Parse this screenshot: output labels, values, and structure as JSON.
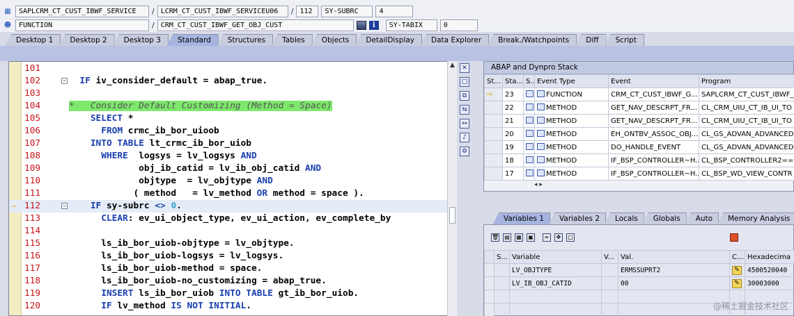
{
  "header": {
    "row1": [
      "SAPLCRM_CT_CUST_IBWF_SERVICE",
      "LCRM_CT_CUST_IBWF_SERVICEU06",
      "112",
      "SY-SUBRC",
      "4"
    ],
    "row2": [
      "FUNCTION",
      "CRM_CT_CUST_IBWF_GET_OBJ_CUST",
      "SY-TABIX",
      "0"
    ]
  },
  "tabs": [
    "Desktop 1",
    "Desktop 2",
    "Desktop 3",
    "Standard",
    "Structures",
    "Tables",
    "Objects",
    "DetailDisplay",
    "Data Explorer",
    "Break./Watchpoints",
    "Diff",
    "Script"
  ],
  "active_tab": "Standard",
  "code": {
    "lines": [
      {
        "n": "101",
        "t": ""
      },
      {
        "n": "102",
        "t": "  IF iv_consider_default = abap_true."
      },
      {
        "n": "103",
        "t": ""
      },
      {
        "n": "104",
        "t": "*   Consider Default Customizing (Method = Space)"
      },
      {
        "n": "105",
        "t": "    SELECT *"
      },
      {
        "n": "106",
        "t": "      FROM crmc_ib_bor_uioob"
      },
      {
        "n": "107",
        "t": "    INTO TABLE lt_crmc_ib_bor_uiob"
      },
      {
        "n": "108",
        "t": "      WHERE  logsys = lv_logsys AND"
      },
      {
        "n": "109",
        "t": "             obj_ib_catid = lv_ib_obj_catid AND"
      },
      {
        "n": "110",
        "t": "             objtype  = lv_objtype AND"
      },
      {
        "n": "111",
        "t": "            ( method   = lv_method OR method = space )."
      },
      {
        "n": "112",
        "t": "    IF sy-subrc <> 0."
      },
      {
        "n": "113",
        "t": "      CLEAR: ev_ui_object_type, ev_ui_action, ev_complete_by"
      },
      {
        "n": "114",
        "t": ""
      },
      {
        "n": "115",
        "t": "      ls_ib_bor_uiob-objtype = lv_objtype."
      },
      {
        "n": "116",
        "t": "      ls_ib_bor_uiob-logsys = lv_logsys."
      },
      {
        "n": "117",
        "t": "      ls_ib_bor_uiob-method = space."
      },
      {
        "n": "118",
        "t": "      ls_ib_bor_uiob-no_customizing = abap_true."
      },
      {
        "n": "119",
        "t": "      INSERT ls_ib_bor_uiob INTO TABLE gt_ib_bor_uiob."
      },
      {
        "n": "120",
        "t": "      IF lv_method IS NOT INITIAL."
      }
    ],
    "current_line": "112"
  },
  "stack": {
    "title": "ABAP and Dynpro Stack",
    "columns": [
      "St...",
      "Sta...",
      "S...",
      "Event Type",
      "Event",
      "Program"
    ],
    "rows": [
      {
        "level": "23",
        "type": "FUNCTION",
        "event": "CRM_CT_CUST_IBWF_G...",
        "program": "SAPLCRM_CT_CUST_IBWF_"
      },
      {
        "level": "22",
        "type": "METHOD",
        "event": "GET_NAV_DESCRPT_FR...",
        "program": "CL_CRM_UIU_CT_IB_UI_TO"
      },
      {
        "level": "21",
        "type": "METHOD",
        "event": "GET_NAV_DESCRPT_FR...",
        "program": "CL_CRM_UIU_CT_IB_UI_TO"
      },
      {
        "level": "20",
        "type": "METHOD",
        "event": "EH_ONTBV_ASSOC_OBJ...",
        "program": "CL_GS_ADVAN_ADVANCED"
      },
      {
        "level": "19",
        "type": "METHOD",
        "event": "DO_HANDLE_EVENT",
        "program": "CL_GS_ADVAN_ADVANCED"
      },
      {
        "level": "18",
        "type": "METHOD",
        "event": "IF_BSP_CONTROLLER~H...",
        "program": "CL_BSP_CONTROLLER2==="
      },
      {
        "level": "17",
        "type": "METHOD",
        "event": "IF_BSP_CONTROLLER~H...",
        "program": "CL_BSP_WD_VIEW_CONTR"
      }
    ]
  },
  "var_tabs": [
    "Variables 1",
    "Variables 2",
    "Locals",
    "Globals",
    "Auto",
    "Memory Analysis"
  ],
  "variables": {
    "columns": [
      "S...",
      "Variable",
      "V...",
      "Val.",
      "C...",
      "Hexadecima"
    ],
    "rows": [
      {
        "name": "LV_OBJTYPE",
        "value": "ERMSSUPRT2",
        "hex": "4500520040"
      },
      {
        "name": "LV_IB_OBJ_CATID",
        "value": "00",
        "hex": "30003000"
      }
    ]
  },
  "watermark": "@稀土掘金技术社区"
}
